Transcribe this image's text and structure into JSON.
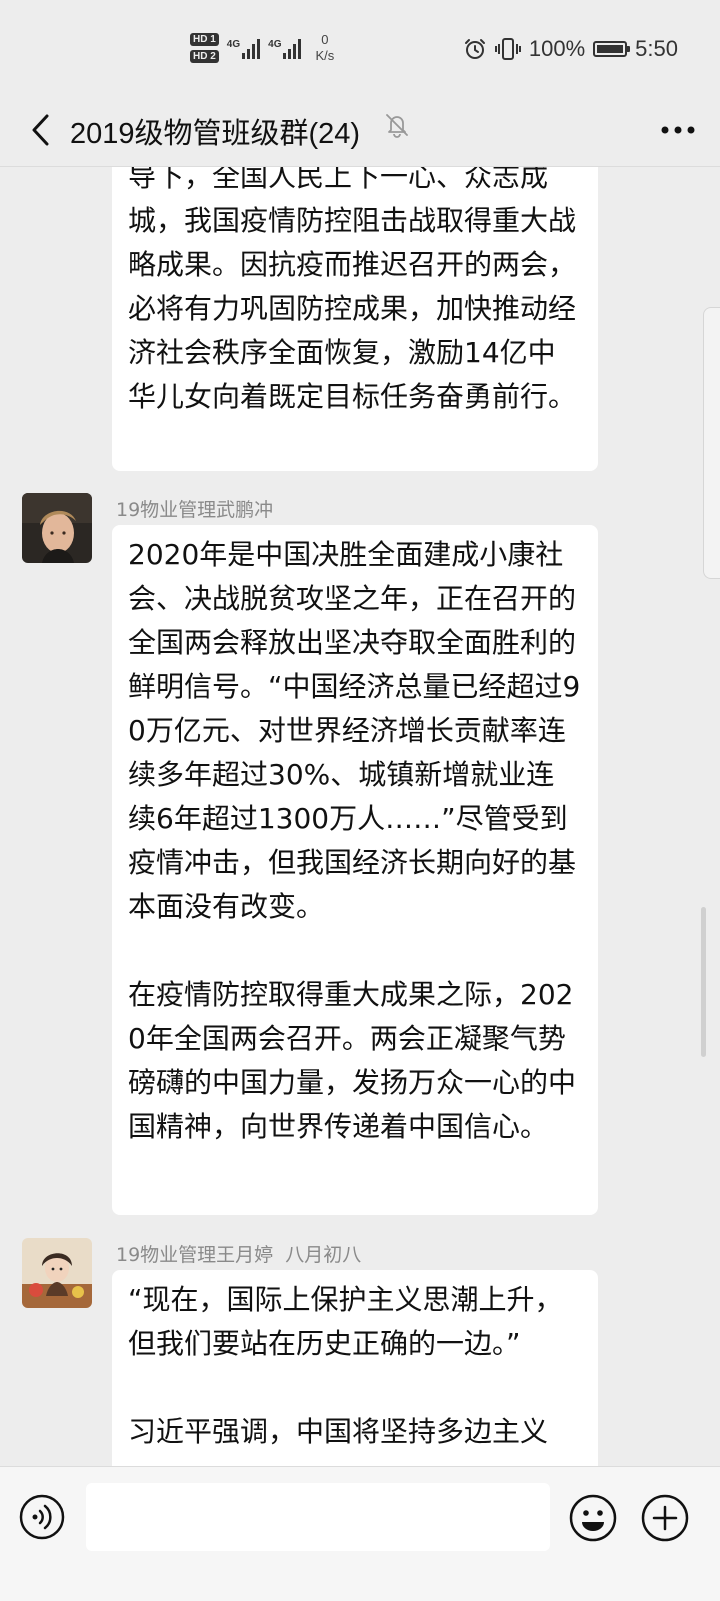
{
  "status_bar": {
    "sim1_label": "HD 1",
    "sim2_label": "HD 2",
    "network_type": "4G",
    "network_type_2": "4G",
    "speed_value": "0",
    "speed_unit": "K/s",
    "battery": "100%",
    "time": "5:50",
    "icons": [
      "alarm-icon",
      "vibrate-icon",
      "battery-icon"
    ]
  },
  "header": {
    "title": "2019级物管班级群(24)",
    "back_icon": "chevron-left-icon",
    "mute_icon": "bell-off-icon",
    "more_icon": "more-dots-icon"
  },
  "messages": [
    {
      "sender": "",
      "text": "导下，全国人民上下一心、众志成城，我国疫情防控阻击战取得重大战略成果。因抗疫而推迟召开的两会，必将有力巩固防控成果，加快推动经济社会秩序全面恢复，激励14亿中华儿女向着既定目标任务奋勇前行。"
    },
    {
      "sender": "19物业管理武鹏冲",
      "sender_note": "",
      "text": "2020年是中国决胜全面建成小康社会、决战脱贫攻坚之年，正在召开的全国两会释放出坚决夺取全面胜利的鲜明信号。“中国经济总量已经超过90万亿元、对世界经济增长贡献率连续多年超过30%、城镇新增就业连续6年超过1300万人……”尽管受到疫情冲击，但我国经济长期向好的基本面没有改变。\n\n在疫情防控取得重大成果之际，2020年全国两会召开。两会正凝聚气势磅礴的中国力量，发扬万众一心的中国精神，向世界传递着中国信心。"
    },
    {
      "sender": "19物业管理王月婷",
      "sender_note": "八月初八",
      "text": "“现在，国际上保护主义思潮上升，但我们要站在历史正确的一边。”\n\n习近平强调，中国将坚持多边主义"
    }
  ],
  "input_bar": {
    "placeholder": "",
    "voice_icon": "voice-icon",
    "emoji_icon": "emoji-icon",
    "add_icon": "plus-icon"
  },
  "colors": {
    "background": "#ededed",
    "bubble": "#ffffff",
    "sender_text": "#8a8a8a"
  }
}
